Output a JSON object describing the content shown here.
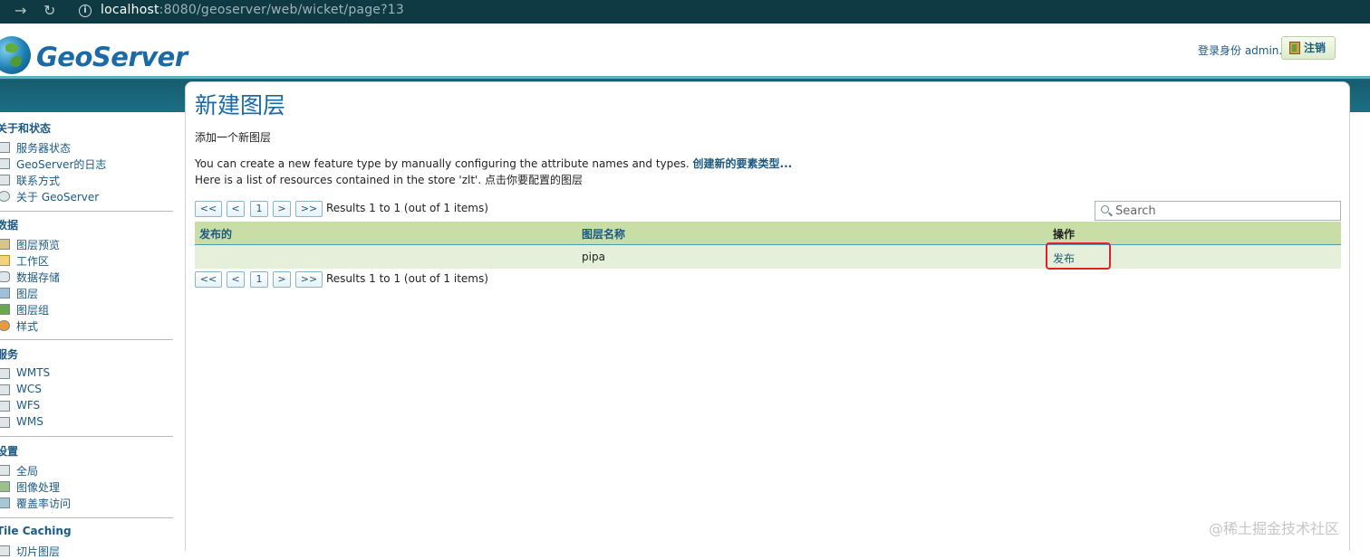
{
  "browser": {
    "url_host": "localhost",
    "url_rest": ":8080/geoserver/web/wicket/page?13"
  },
  "header": {
    "logo_text": "GeoServer",
    "login_text": "登录身份 admin.",
    "logout_label": "注销"
  },
  "sidebar": {
    "sections": [
      {
        "title": "关于和状态",
        "items": [
          {
            "label": "服务器状态",
            "icon": "server-status-icon"
          },
          {
            "label": "GeoServer的日志",
            "icon": "log-icon"
          },
          {
            "label": "联系方式",
            "icon": "contact-icon"
          },
          {
            "label": "关于 GeoServer",
            "icon": "about-icon"
          }
        ]
      },
      {
        "title": "数据",
        "items": [
          {
            "label": "图层预览",
            "icon": "layer-preview-icon"
          },
          {
            "label": "工作区",
            "icon": "workspace-folder-icon"
          },
          {
            "label": "数据存储",
            "icon": "datastore-icon"
          },
          {
            "label": "图层",
            "icon": "layers-icon"
          },
          {
            "label": "图层组",
            "icon": "layer-group-icon"
          },
          {
            "label": "样式",
            "icon": "styles-icon"
          }
        ]
      },
      {
        "title": "服务",
        "items": [
          {
            "label": "WMTS",
            "icon": "wmts-icon"
          },
          {
            "label": "WCS",
            "icon": "wcs-icon"
          },
          {
            "label": "WFS",
            "icon": "wfs-icon"
          },
          {
            "label": "WMS",
            "icon": "wms-icon"
          }
        ]
      },
      {
        "title": "设置",
        "items": [
          {
            "label": "全局",
            "icon": "global-settings-icon"
          },
          {
            "label": "图像处理",
            "icon": "image-processing-icon"
          },
          {
            "label": "覆盖率访问",
            "icon": "coverage-access-icon"
          }
        ]
      },
      {
        "title": "Tile Caching",
        "items": [
          {
            "label": "切片图层",
            "icon": "tile-layers-icon"
          }
        ]
      }
    ]
  },
  "main": {
    "title": "新建图层",
    "description": "添加一个新图层",
    "info_text": "You can create a new feature type by manually configuring the attribute names and types.",
    "create_link": "创建新的要素类型...",
    "store_text": "Here is a list of resources contained in the store 'zlt'. 点击你要配置的图层",
    "pager": {
      "first": "<<",
      "prev": "<",
      "page": "1",
      "next": ">",
      "last": ">>",
      "results": "Results 1 to 1 (out of 1 items)"
    },
    "search_placeholder": "Search",
    "table": {
      "headers": [
        "发布的",
        "图层名称",
        "操作"
      ],
      "rows": [
        {
          "published": "",
          "name": "pipa",
          "action": "发布"
        }
      ]
    }
  },
  "watermark": "@稀土掘金技术社区",
  "colors": {
    "browser_bar": "#0f3a44",
    "band": "#1b6f84",
    "accent_blue": "#1a5a85",
    "table_header": "#c8dea6",
    "table_row": "#e6efd9",
    "highlight_red": "#e0212a"
  }
}
